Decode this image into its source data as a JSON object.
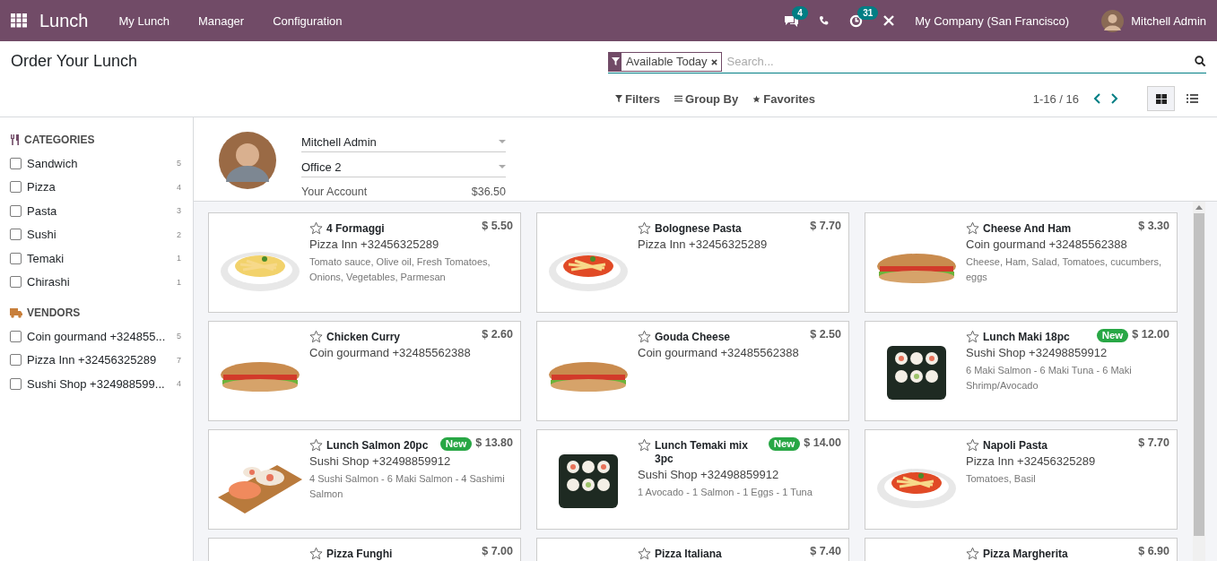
{
  "navbar": {
    "app_name": "Lunch",
    "menu": [
      "My Lunch",
      "Manager",
      "Configuration"
    ],
    "messages_count": "4",
    "activities_count": "31",
    "company": "My Company (San Francisco)",
    "user": "Mitchell Admin"
  },
  "control_panel": {
    "title": "Order Your Lunch",
    "facet": "Available Today",
    "search": {
      "placeholder": "Search..."
    },
    "buttons": [
      "Filters",
      "Group By",
      "Favorites"
    ],
    "pager": "1-16 / 16",
    "views": [
      {
        "kind": "kanban",
        "selected": true
      },
      {
        "kind": "list",
        "selected": false
      }
    ]
  },
  "sidebar": {
    "sections": [
      {
        "kind": "categories",
        "title": "CATEGORIES",
        "items": [
          {
            "label": "Sandwich",
            "count": "5",
            "checked": false
          },
          {
            "label": "Pizza",
            "count": "4",
            "checked": false
          },
          {
            "label": "Pasta",
            "count": "3",
            "checked": false
          },
          {
            "label": "Sushi",
            "count": "2",
            "checked": false
          },
          {
            "label": "Temaki",
            "count": "1",
            "checked": false
          },
          {
            "label": "Chirashi",
            "count": "1",
            "checked": false
          }
        ]
      },
      {
        "kind": "vendors",
        "title": "VENDORS",
        "items": [
          {
            "label": "Coin gourmand +324855...",
            "count": "5",
            "checked": false
          },
          {
            "label": "Pizza Inn +32456325289",
            "count": "7",
            "checked": false
          },
          {
            "label": "Sushi Shop +324988599...",
            "count": "4",
            "checked": false
          }
        ]
      }
    ]
  },
  "account": {
    "user": "Mitchell Admin",
    "location": "Office 2",
    "label": "Your Account",
    "balance": "$36.50"
  },
  "products": [
    {
      "name": "4 Formaggi",
      "price": "$ 5.50",
      "vendor": "Pizza Inn +32456325289",
      "description": "Tomato sauce, Olive oil, Fresh Tomatoes, Onions, Vegetables, Parmesan",
      "favorite": false
    },
    {
      "name": "Bolognese Pasta",
      "price": "$ 7.70",
      "vendor": "Pizza Inn +32456325289",
      "favorite": false
    },
    {
      "name": "Cheese And Ham",
      "price": "$ 3.30",
      "vendor": "Coin gourmand +32485562388",
      "description": "Cheese, Ham, Salad, Tomatoes, cucumbers, eggs",
      "favorite": false
    },
    {
      "name": "Chicken Curry",
      "price": "$ 2.60",
      "vendor": "Coin gourmand +32485562388",
      "favorite": false
    },
    {
      "name": "Gouda Cheese",
      "price": "$ 2.50",
      "vendor": "Coin gourmand +32485562388",
      "favorite": false
    },
    {
      "name": "Lunch Maki 18pc",
      "badge": "New",
      "price": "$ 12.00",
      "vendor": "Sushi Shop +32498859912",
      "description": "6 Maki Salmon - 6 Maki Tuna - 6 Maki Shrimp/Avocado",
      "favorite": false
    },
    {
      "name": "Lunch Salmon 20pc",
      "badge": "New",
      "price": "$ 13.80",
      "vendor": "Sushi Shop +32498859912",
      "description": "4 Sushi Salmon - 6 Maki Salmon - 4 Sashimi Salmon",
      "favorite": false
    },
    {
      "name": "Lunch Temaki mix 3pc",
      "badge": "New",
      "price": "$ 14.00",
      "vendor": "Sushi Shop +32498859912",
      "description": "1 Avocado - 1 Salmon - 1 Eggs - 1 Tuna",
      "favorite": false
    },
    {
      "name": "Napoli Pasta",
      "price": "$ 7.70",
      "vendor": "Pizza Inn +32456325289",
      "description": "Tomatoes, Basil",
      "favorite": false
    },
    {
      "name": "Pizza Funghi",
      "price": "$ 7.00",
      "favorite": false
    },
    {
      "name": "Pizza Italiana",
      "price": "$ 7.40",
      "favorite": false
    },
    {
      "name": "Pizza Margherita",
      "price": "$ 6.90",
      "favorite": false
    }
  ]
}
